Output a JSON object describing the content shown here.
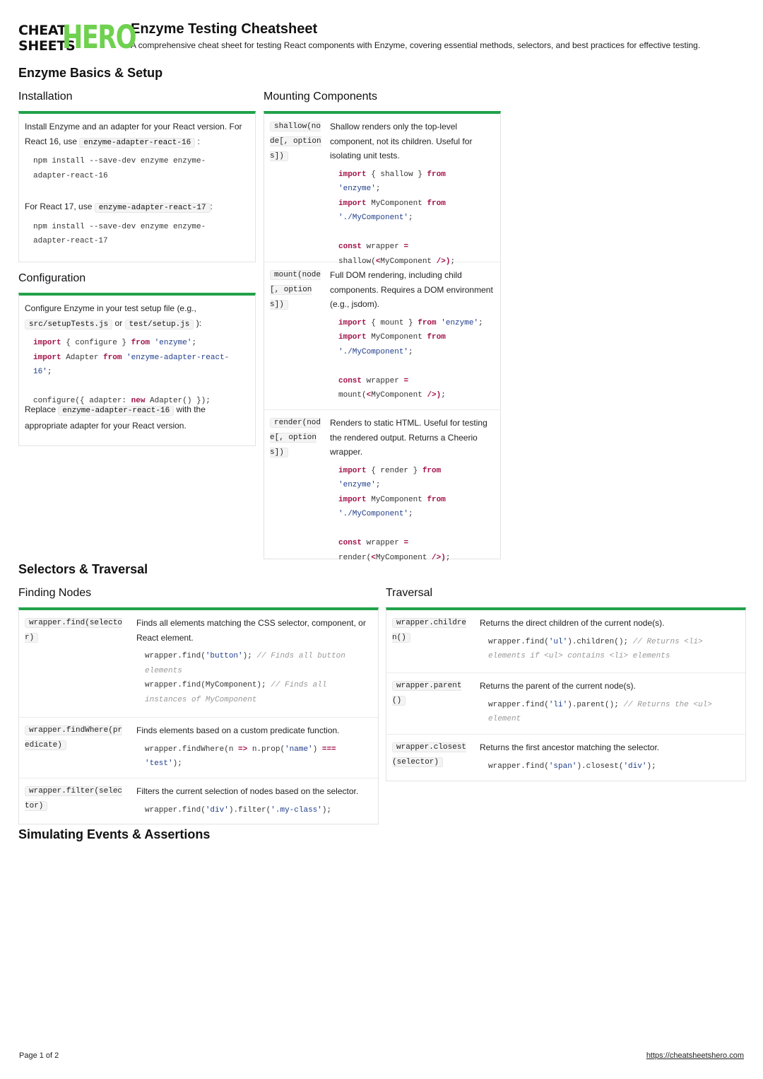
{
  "brand": {
    "logo_line1": "CHEAT",
    "logo_line2": "SHEETS",
    "logo_hero": "HERO"
  },
  "header": {
    "title": "Enzyme Testing Cheatsheet",
    "subtitle": "A comprehensive cheat sheet for testing React components with Enzyme, covering essential methods, selectors, and best practices for effective testing."
  },
  "sections": {
    "basics": "Enzyme Basics & Setup",
    "selectors": "Selectors & Traversal",
    "events": "Simulating Events & Assertions"
  },
  "installation": {
    "title": "Installation",
    "p1_a": "Install Enzyme and an adapter for your React version. For React 16, use ",
    "p1_code": "enzyme-adapter-react-16",
    "p1_b": " :",
    "code1": "npm install --save-dev enzyme enzyme-adapter-react-16",
    "p2_a": "For React 17, use ",
    "p2_code": "enzyme-adapter-react-17",
    "p2_b": ":",
    "code2": "npm install --save-dev enzyme enzyme-adapter-react-17"
  },
  "configuration": {
    "title": "Configuration",
    "p1_a": "Configure Enzyme in your test setup file (e.g., ",
    "p1_code1": "src/setupTests.js",
    "p1_or": " or ",
    "p1_code2": "test/setup.js",
    "p1_b": " ):",
    "p2_a": "Replace ",
    "p2_code": "enzyme-adapter-react-16",
    "p2_b": " with the appropriate adapter for your React version."
  },
  "mounting": {
    "title": "Mounting Components",
    "rows": [
      {
        "sig": "shallow(node[, options])",
        "desc": "Shallow renders only the top-level component, not its children. Useful for isolating unit tests.",
        "fn": "shallow",
        "call": "shallow"
      },
      {
        "sig": "mount(node[, options])",
        "desc": "Full DOM rendering, including child components. Requires a DOM environment (e.g., jsdom).",
        "fn": "mount",
        "call": "mount"
      },
      {
        "sig": "render(node[, options])",
        "desc": "Renders to static HTML. Useful for testing the rendered output. Returns a Cheerio wrapper.",
        "fn": "render",
        "call": "render"
      }
    ]
  },
  "finding": {
    "title": "Finding Nodes",
    "rows": [
      {
        "sig": "wrapper.find(selector)",
        "desc": "Finds all elements matching the CSS selector, component, or React element."
      },
      {
        "sig": "wrapper.findWhere(predicate)",
        "desc": "Finds elements based on a custom predicate function."
      },
      {
        "sig": "wrapper.filter(selector)",
        "desc": "Filters the current selection of nodes based on the selector."
      }
    ]
  },
  "traversal": {
    "title": "Traversal",
    "rows": [
      {
        "sig": "wrapper.children()",
        "desc": "Returns the direct children of the current node(s)."
      },
      {
        "sig": "wrapper.parent()",
        "desc": "Returns the parent of the current node(s)."
      },
      {
        "sig": "wrapper.closest(selector)",
        "desc": "Returns the first ancestor matching the selector."
      }
    ]
  },
  "footer": {
    "page": "Page 1 of 2",
    "url": "https://cheatsheetshero.com"
  }
}
